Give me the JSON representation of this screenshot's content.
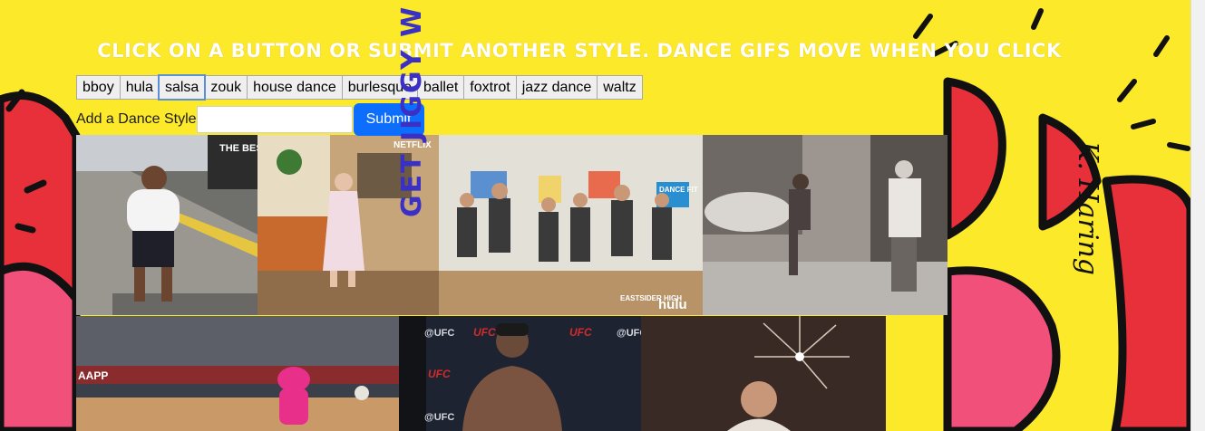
{
  "headline": "Click on a button or submit another style. Dance gifs move when you click",
  "dance_buttons": [
    "bboy",
    "hula",
    "salsa",
    "zouk",
    "house dance",
    "burlesque",
    "ballet",
    "foxtrot",
    "jazz dance",
    "waltz"
  ],
  "focused_button": "salsa",
  "add_form": {
    "label": "Add a Dance Style",
    "input_value": "",
    "submit_label": "Submit"
  },
  "banner_text": "GET JIGGY W",
  "artist_signature": "K. Haring",
  "gifs": {
    "gif1": {
      "sign_text": "THE BEST"
    },
    "gif2": {
      "watermark": "NETFLIX"
    },
    "gif3": {
      "watermark": "hulu",
      "logo": "EASTSIDER HIGH",
      "sign_text": "DANCE FIT"
    },
    "gif5": {
      "jumbotron": "AAPP"
    },
    "gif6": {
      "tag": "@UFC",
      "logo": "UFC"
    }
  },
  "colors": {
    "background": "#fce92a",
    "submit": "#0d6efd",
    "haring_red": "#e8303a",
    "haring_pink": "#f0507a"
  }
}
